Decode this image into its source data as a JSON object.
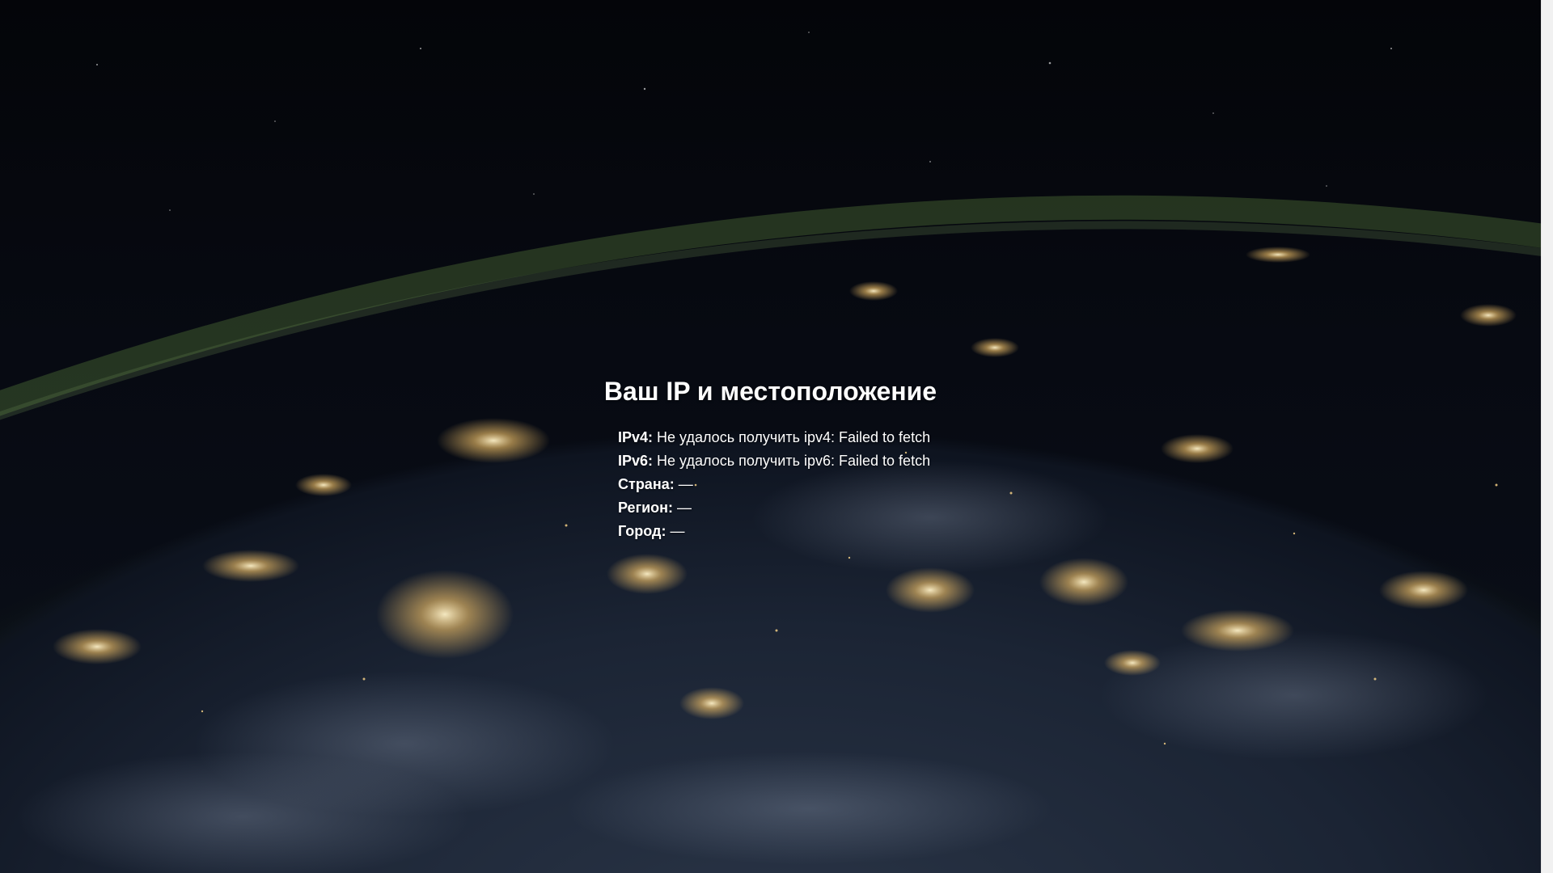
{
  "page": {
    "title": "Ваш IP и местоположение"
  },
  "info": [
    {
      "label": "IPv4:",
      "value": "Не удалось получить ipv4: Failed to fetch"
    },
    {
      "label": "IPv6:",
      "value": "Не удалось получить ipv6: Failed to fetch"
    },
    {
      "label": "Страна:",
      "value": "—"
    },
    {
      "label": "Регион:",
      "value": "—"
    },
    {
      "label": "Город:",
      "value": "—"
    }
  ],
  "background": {
    "description_icon": "earth-at-night-image",
    "colors": {
      "space": "#05070d",
      "atmosphere": "#3d5a2e",
      "city_lights": "#f5c46a"
    }
  }
}
